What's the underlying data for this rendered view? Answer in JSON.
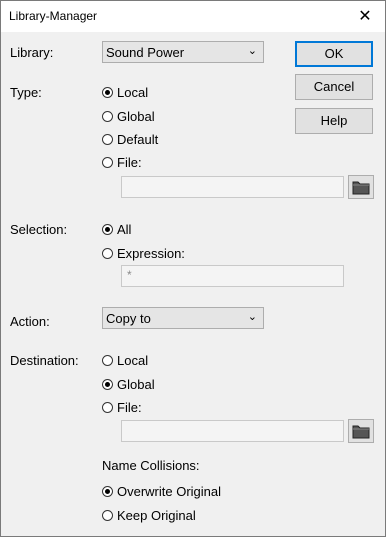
{
  "window": {
    "title": "Library-Manager",
    "close_glyph": "✕"
  },
  "library": {
    "label": "Library:",
    "value": "Sound Power"
  },
  "type": {
    "label": "Type:",
    "options": [
      {
        "label": "Local",
        "checked": true
      },
      {
        "label": "Global",
        "checked": false
      },
      {
        "label": "Default",
        "checked": false
      },
      {
        "label": "File:",
        "checked": false
      }
    ],
    "file_value": ""
  },
  "selection": {
    "label": "Selection:",
    "options": [
      {
        "label": "All",
        "checked": true
      },
      {
        "label": "Expression:",
        "checked": false
      }
    ],
    "expression_value": "*"
  },
  "action": {
    "label": "Action:",
    "value": "Copy to"
  },
  "destination": {
    "label": "Destination:",
    "options": [
      {
        "label": "Local",
        "checked": false
      },
      {
        "label": "Global",
        "checked": true
      },
      {
        "label": "File:",
        "checked": false
      }
    ],
    "file_value": ""
  },
  "collisions": {
    "label": "Name Collisions:",
    "options": [
      {
        "label": "Overwrite Original",
        "checked": true
      },
      {
        "label": "Keep Original",
        "checked": false
      }
    ]
  },
  "buttons": {
    "ok": "OK",
    "cancel": "Cancel",
    "help": "Help"
  },
  "icons": {
    "dropdown": "chevron-down-icon",
    "folder": "folder-icon",
    "close": "close-icon"
  }
}
